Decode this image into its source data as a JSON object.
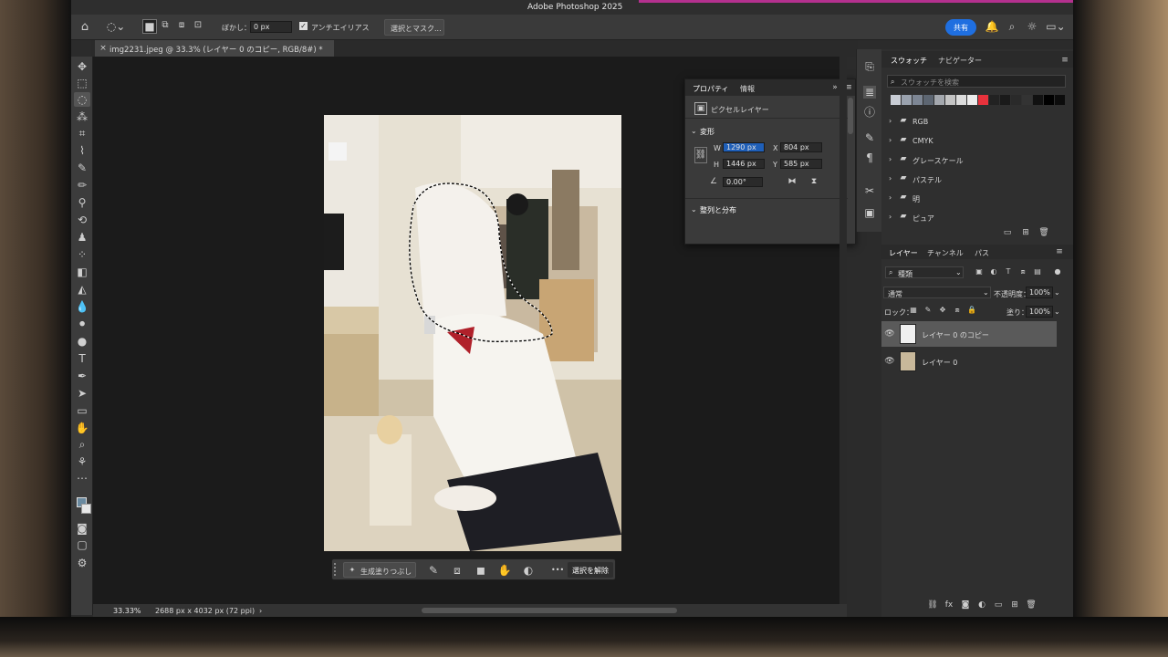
{
  "window": {
    "title": "Adobe Photoshop 2025"
  },
  "options_bar": {
    "feather_label": "ぼかし：",
    "feather_value": "0 px",
    "antialias_label": "アンチエイリアス",
    "select_mask_button": "選択とマスク..."
  },
  "header_right": {
    "share_button": "共有"
  },
  "document_tab": {
    "title": "img2231.jpeg @ 33.3% (レイヤー 0 のコピー, RGB/8#) *"
  },
  "properties_panel": {
    "tabs": [
      "プロパティ",
      "情報"
    ],
    "layer_type": "ピクセルレイヤー",
    "transform_section": "変形",
    "w_label": "W",
    "w_value": "1290 px",
    "x_label": "X",
    "x_value": "804 px",
    "h_label": "H",
    "h_value": "1446 px",
    "y_label": "Y",
    "y_value": "585 px",
    "angle_value": "0.00°",
    "align_section": "整列と分布"
  },
  "context_bar": {
    "generative_fill": "生成塗りつぶし",
    "deselect": "選択を解除",
    "more": "•••"
  },
  "status_bar": {
    "zoom": "33.33%",
    "doc_info": "2688 px x 4032 px (72 ppi)"
  },
  "swatches_panel": {
    "tabs": [
      "スウォッチ",
      "ナビゲーター"
    ],
    "search_placeholder": "スウォッチを検索",
    "colors": [
      "#c8ccd4",
      "#9aa2ae",
      "#7d8694",
      "#5d6672",
      "#a4a8ae",
      "#c4c4c4",
      "#dcdcdc",
      "#ececec",
      "#e8323c",
      "#222222",
      "#1a1a1a",
      "#2a2a2a",
      "#333333",
      "#111111",
      "#000000",
      "#0c0c0c"
    ],
    "groups": [
      "RGB",
      "CMYK",
      "グレースケール",
      "パステル",
      "明",
      "ピュア"
    ]
  },
  "layers_panel": {
    "tabs": [
      "レイヤー",
      "チャンネル",
      "パス"
    ],
    "filter_label": "種類",
    "blend_mode": "通常",
    "opacity_label": "不透明度：",
    "opacity_value": "100%",
    "lock_label": "ロック：",
    "fill_label": "塗り：",
    "fill_value": "100%",
    "layers": [
      {
        "name": "レイヤー 0 のコピー",
        "selected": true
      },
      {
        "name": "レイヤー 0",
        "selected": false
      }
    ]
  }
}
